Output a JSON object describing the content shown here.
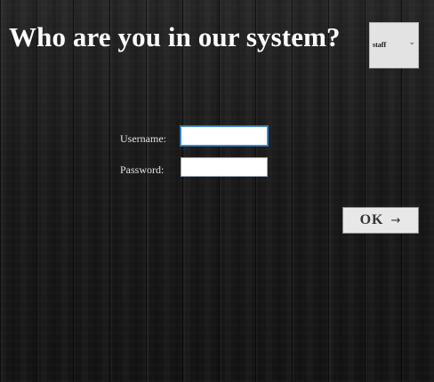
{
  "header": {
    "title": "Who are you in our system?"
  },
  "role_select": {
    "selected": "staff",
    "icon": "chevron-down-icon"
  },
  "form": {
    "username_label": "Username:",
    "username_value": "",
    "password_label": "Password:",
    "password_value": ""
  },
  "submit": {
    "label": "OK",
    "icon_glyph": "→",
    "icon": "arrow-right-icon"
  }
}
